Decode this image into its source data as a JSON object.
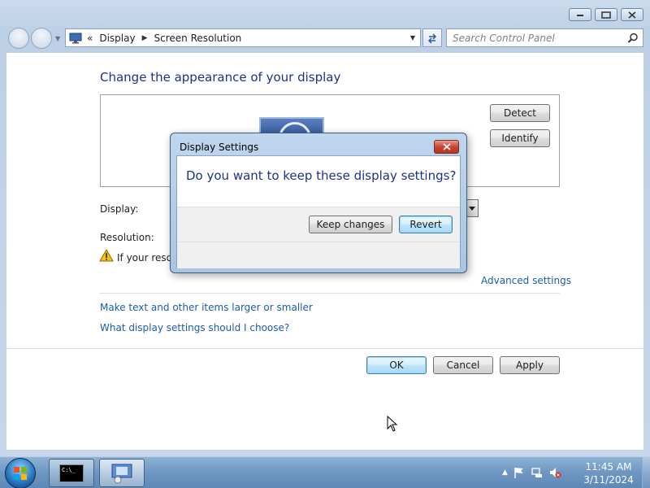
{
  "window": {
    "controls": {
      "minimize_icon": "minimize-icon",
      "maximize_icon": "maximize-icon",
      "close_icon": "close-icon"
    }
  },
  "navigation": {
    "breadcrumb_root_marker": "«",
    "breadcrumb": [
      "Display",
      "Screen Resolution"
    ],
    "search_placeholder": "Search Control Panel"
  },
  "main": {
    "title": "Change the appearance of your display",
    "detect_label": "Detect",
    "identify_label": "Identify",
    "display_label": "Display:",
    "resolution_label": "Resolution:",
    "warning_text": "If your resolu",
    "advanced_link": "Advanced settings",
    "link_text_size": "Make text and other items larger or smaller",
    "link_help": "What display settings should I choose?",
    "ok_label": "OK",
    "cancel_label": "Cancel",
    "apply_label": "Apply"
  },
  "dialog": {
    "title": "Display Settings",
    "question": "Do you want to keep these display settings?",
    "keep_label": "Keep changes",
    "revert_label": "Revert"
  },
  "taskbar": {
    "time": "11:45 AM",
    "date": "3/11/2024",
    "cmd_icon_text": "C:\\_"
  },
  "colors": {
    "title_blue": "#1e3287",
    "link_blue": "#1c5ca8",
    "taskbar": "#6e96c2"
  }
}
